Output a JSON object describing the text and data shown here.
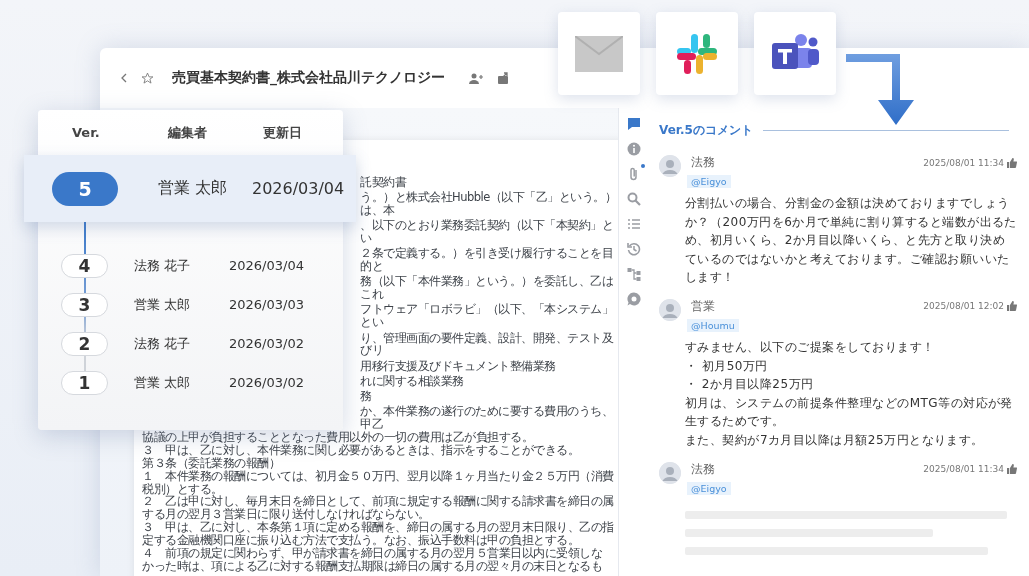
{
  "window": {
    "title": "売買基本契約書_株式会社品川テクノロジー"
  },
  "integrations": [
    {
      "kind": "mail"
    },
    {
      "kind": "slack"
    },
    {
      "kind": "teams"
    }
  ],
  "version_history": {
    "columns": [
      "Ver.",
      "編集者",
      "更新日"
    ],
    "rows": [
      {
        "version": "5",
        "editor": "営業 太郎",
        "date": "2026/03/04",
        "selected": true
      },
      {
        "version": "4",
        "editor": "法務 花子",
        "date": "2026/03/04",
        "selected": false
      },
      {
        "version": "3",
        "editor": "営業 太郎",
        "date": "2026/03/03",
        "selected": false
      },
      {
        "version": "2",
        "editor": "法務 花子",
        "date": "2026/03/02",
        "selected": false
      },
      {
        "version": "1",
        "editor": "営業 太郎",
        "date": "2026/03/02",
        "selected": false
      }
    ]
  },
  "document": {
    "upper_lines": [
      "託契約書",
      "う。）と株式会社Hubble（以下「乙」という。）は、本",
      "、以下のとおり業務委託契約（以下「本契約」とい",
      "２条で定義する。）を引き受け履行することを目的と",
      "務（以下「本件業務」という。）を委託し、乙はこれ",
      "フトウェア「ロボラビ」（以下、「本システム」とい",
      "り、管理画面の要件定義、設計、開発、テスト及びリ",
      "用移行支援及びドキュメント整備業務",
      "れに関する相談業務",
      "務",
      "か、本件業務の遂行のために要する費用のうち、甲乙"
    ],
    "lower_lines": [
      "協議の上甲が負担することとなった費用以外の一切の費用は乙が負担する。",
      "３　甲は、乙に対し、本件業務に関し必要があるときは、指示をすることができる。",
      "第３条（委託業務の報酬）",
      "１　本件業務の報酬については、初月金５０万円、翌月以降１ヶ月当たり金２５万円（消費",
      "税別）とする。",
      "２　乙は甲に対し、毎月末日を締日として、前項に規定する報酬に関する請求書を締日の属",
      "する月の翌月３営業日に限り送付しなければならない。",
      "３　甲は、乙に対し、本条第１項に定める報酬を、締日の属する月の翌月末日限り、乙の指",
      "定する金融機関口座に振り込む方法で支払う。なお、振込手数料は甲の負担とする。",
      "４　前項の規定に関わらず、甲が請求書を締日の属する月の翌月５営業日以内に受領しな",
      "かった時は、項による乙に対する報酬支払期限は締日の属する月の翌々月の末日となるも"
    ]
  },
  "sidebar": {
    "items": [
      {
        "kind": "comment",
        "selected": true,
        "notification": false
      },
      {
        "kind": "info",
        "selected": false,
        "notification": false
      },
      {
        "kind": "attachment",
        "selected": false,
        "notification": true
      },
      {
        "kind": "search",
        "selected": false,
        "notification": false
      },
      {
        "kind": "list",
        "selected": false,
        "notification": false
      },
      {
        "kind": "history",
        "selected": false,
        "notification": false
      },
      {
        "kind": "flow",
        "selected": false,
        "notification": false
      },
      {
        "kind": "chat",
        "selected": false,
        "notification": false
      }
    ]
  },
  "comments": {
    "title": "Ver.5のコメント",
    "items": [
      {
        "author": "法務",
        "mention": "@Eigyo",
        "time": "2025/08/01 11:34",
        "lines": [
          "分割払いの場合、分割金の金額は決めておりますでしょうか？（200万円を6か月で単純に割り算すると端数が出るため、初月いくら、2か月目以降いくら、と先方と取り決めているのではないかと考えております。ご確認お願いいたします！"
        ]
      },
      {
        "author": "営業",
        "mention": "@Houmu",
        "time": "2025/08/01 12:02",
        "lines": [
          "すみません、以下のご提案をしております！",
          "・ 初月50万円",
          "・ 2か月目以降25万円",
          "初月は、システムの前提条件整理などのMTG等の対応が発生するためです。",
          "また、契約が7カ月目以降は月額25万円となります。"
        ]
      },
      {
        "author": "法務",
        "mention": "@Eigyo",
        "time": "2025/08/01 11:34"
      }
    ]
  }
}
